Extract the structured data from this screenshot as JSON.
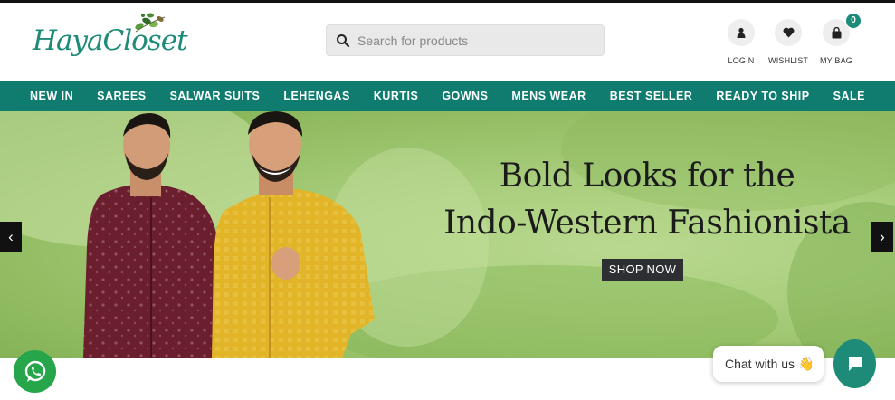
{
  "brand": {
    "logo_text": "HayaCloset"
  },
  "search": {
    "placeholder": "Search for products",
    "value": ""
  },
  "header_actions": {
    "login_label": "LOGIN",
    "wishlist_label": "WISHLIST",
    "bag_label": "MY BAG",
    "bag_count": "0"
  },
  "nav": {
    "items": [
      "NEW IN",
      "SAREES",
      "SALWAR SUITS",
      "LEHENGAS",
      "KURTIS",
      "GOWNS",
      "MENS WEAR",
      "BEST SELLER",
      "READY TO SHIP",
      "SALE"
    ]
  },
  "hero": {
    "headline_line1": "Bold Looks for the",
    "headline_line2": "Indo-Western Fashionista",
    "cta_label": "SHOP NOW",
    "prev_arrow": "‹",
    "next_arrow": "›"
  },
  "chat": {
    "bubble_text": "Chat with us",
    "emoji": "👋"
  },
  "colors": {
    "brand_teal": "#0f7c6f",
    "hero_green": "#a9ce7d",
    "maroon": "#6b1f2e",
    "mustard": "#e2b529"
  },
  "icons": [
    "search-icon",
    "user-icon",
    "heart-icon",
    "bag-icon",
    "chevron-left-icon",
    "chevron-right-icon",
    "whatsapp-icon",
    "chat-icon"
  ]
}
